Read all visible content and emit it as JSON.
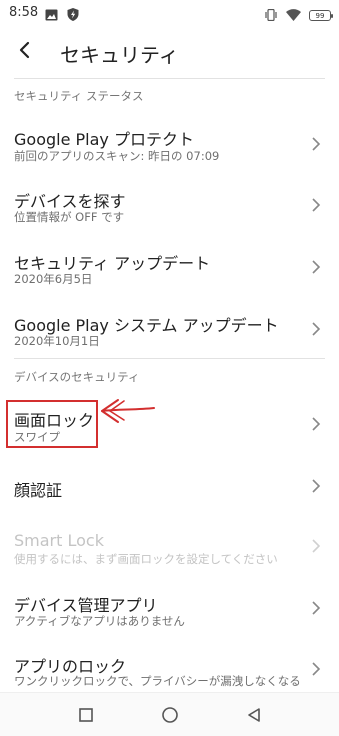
{
  "status_bar": {
    "time": "8:58",
    "battery": "99",
    "icons": [
      "image-icon",
      "shield-icon",
      "vibrate-icon",
      "wifi-icon",
      "battery-icon"
    ]
  },
  "header": {
    "title": "セキュリティ",
    "back_icon": "back-arrow-icon"
  },
  "sections": [
    {
      "header": "セキュリティ ステータス"
    },
    {
      "header": "デバイスのセキュリティ"
    }
  ],
  "items": [
    {
      "title": "Google Play プロテクト",
      "subtitle": "前回のアプリのスキャン: 昨日の 07:09",
      "enabled": true
    },
    {
      "title": "デバイスを探す",
      "subtitle": "位置情報が OFF です",
      "enabled": true
    },
    {
      "title": "セキュリティ アップデート",
      "subtitle": "2020年6月5日",
      "enabled": true
    },
    {
      "title": "Google Play システム アップデート",
      "subtitle": "2020年10月1日",
      "enabled": true
    },
    {
      "title": "画面ロック",
      "subtitle": "スワイプ",
      "enabled": true
    },
    {
      "title": "顔認証",
      "subtitle": "",
      "enabled": true
    },
    {
      "title": "Smart Lock",
      "subtitle": "使用するには、まず画面ロックを設定してください",
      "enabled": false
    },
    {
      "title": "デバイス管理アプリ",
      "subtitle": "アクティブなアプリはありません",
      "enabled": true
    },
    {
      "title": "アプリのロック",
      "subtitle": "ワンクリックロックで、プライバシーが漏洩しなくなる",
      "enabled": true
    }
  ],
  "colors": {
    "annotation": "#d32f2f",
    "disabled_text": "#c4c4c4",
    "secondary_text": "#6f6f6f"
  },
  "nav": [
    "recents-square-icon",
    "home-circle-icon",
    "back-triangle-icon"
  ]
}
